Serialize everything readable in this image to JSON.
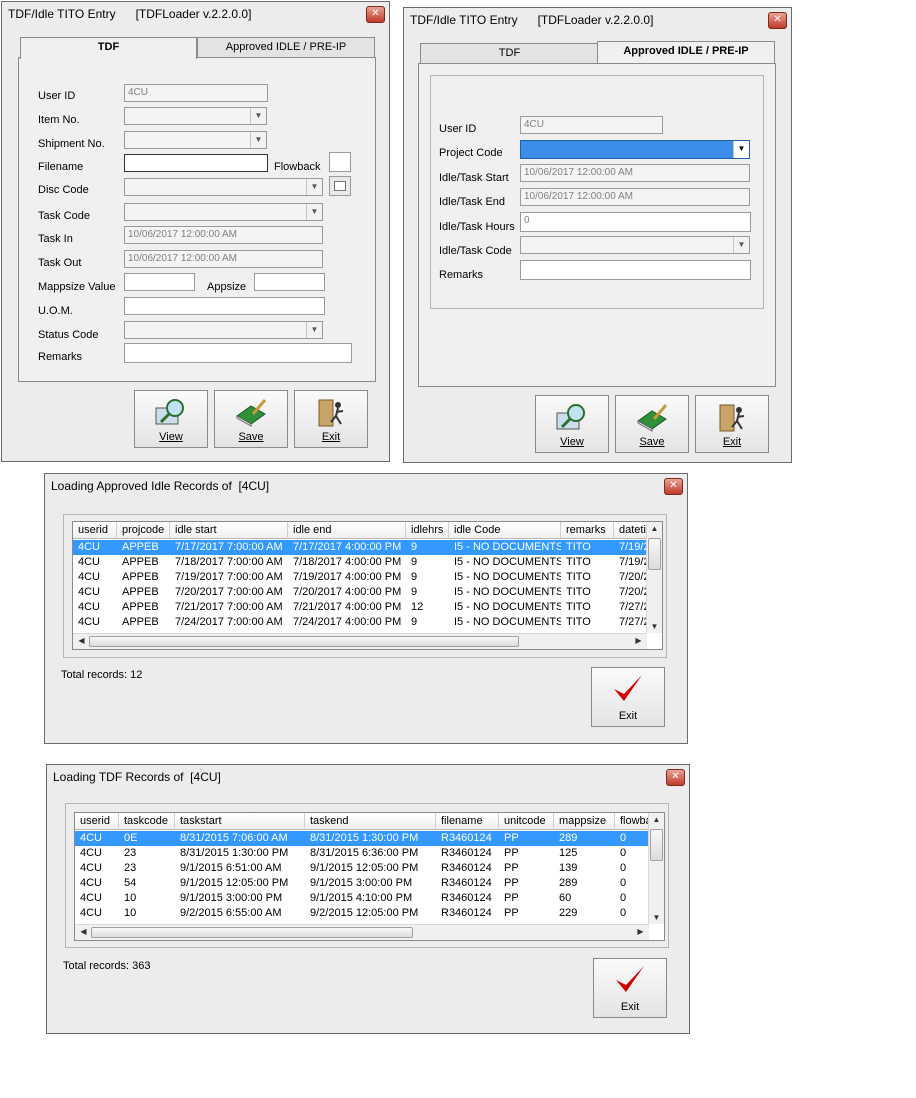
{
  "tdf_window": {
    "title": "TDF/Idle TITO Entry      [TDFLoader v.2.2.0.0]",
    "tabs": [
      "TDF",
      "Approved IDLE / PRE-IP"
    ],
    "labels": {
      "user_id": "User ID",
      "item_no": "Item No.",
      "shipment_no": "Shipment No.",
      "filename": "Filename",
      "flowback": "Flowback",
      "disc_code": "Disc Code",
      "task_code": "Task Code",
      "task_in": "Task In",
      "task_out": "Task Out",
      "mappsize_value": "Mappsize Value",
      "appsize": "Appsize",
      "uom": "U.O.M.",
      "status_code": "Status Code",
      "remarks": "Remarks"
    },
    "values": {
      "user_id": "4CU",
      "task_in": "10/06/2017 12:00:00 AM",
      "task_out": "10/06/2017 12:00:00 AM"
    },
    "buttons": {
      "view": "View",
      "save": "Save",
      "exit": "Exit"
    }
  },
  "idle_window": {
    "title": "TDF/Idle TITO Entry      [TDFLoader v.2.2.0.0]",
    "tabs": [
      "TDF",
      "Approved IDLE / PRE-IP"
    ],
    "labels": {
      "user_id": "User ID",
      "project_code": "Project Code",
      "start": "Idle/Task Start",
      "end": "Idle/Task End",
      "hours": "Idle/Task Hours",
      "code": "Idle/Task Code",
      "remarks": "Remarks"
    },
    "values": {
      "user_id": "4CU",
      "start": "10/06/2017 12:00:00 AM",
      "end": "10/06/2017 12:00:00 AM",
      "hours": "0"
    },
    "buttons": {
      "view": "View",
      "save": "Save",
      "exit": "Exit"
    }
  },
  "idle_records": {
    "title": "Loading Approved Idle Records of  [4CU]",
    "columns": [
      "userid",
      "projcode",
      "idle start",
      "idle end",
      "idlehrs",
      "idle Code",
      "remarks",
      "datetim"
    ],
    "rows": [
      [
        "4CU",
        "APPEB",
        "7/17/2017 7:00:00 AM",
        "7/17/2017 4:00:00 PM",
        "9",
        "I5 - NO DOCUMENTS",
        "TITO",
        "7/19/2"
      ],
      [
        "4CU",
        "APPEB",
        "7/18/2017 7:00:00 AM",
        "7/18/2017 4:00:00 PM",
        "9",
        "I5 - NO DOCUMENTS",
        "TITO",
        "7/19/2"
      ],
      [
        "4CU",
        "APPEB",
        "7/19/2017 7:00:00 AM",
        "7/19/2017 4:00:00 PM",
        "9",
        "I5 - NO DOCUMENTS",
        "TITO",
        "7/20/2"
      ],
      [
        "4CU",
        "APPEB",
        "7/20/2017 7:00:00 AM",
        "7/20/2017 4:00:00 PM",
        "9",
        "I5 - NO DOCUMENTS",
        "TITO",
        "7/20/2"
      ],
      [
        "4CU",
        "APPEB",
        "7/21/2017 7:00:00 AM",
        "7/21/2017 4:00:00 PM",
        "12",
        "I5 - NO DOCUMENTS",
        "TITO",
        "7/27/2"
      ],
      [
        "4CU",
        "APPEB",
        "7/24/2017 7:00:00 AM",
        "7/24/2017 4:00:00 PM",
        "9",
        "I5 - NO DOCUMENTS",
        "TITO",
        "7/27/2"
      ]
    ],
    "total": "Total records: 12",
    "exit": "Exit"
  },
  "tdf_records": {
    "title": "Loading TDF Records of  [4CU]",
    "columns": [
      "userid",
      "taskcode",
      "taskstart",
      "taskend",
      "filename",
      "unitcode",
      "mappsize",
      "flowba"
    ],
    "rows": [
      [
        "4CU",
        "0E",
        "8/31/2015 7:06:00 AM",
        "8/31/2015 1:30:00 PM",
        "R3460124",
        "PP",
        "289",
        "0"
      ],
      [
        "4CU",
        "23",
        "8/31/2015 1:30:00 PM",
        "8/31/2015 6:36:00 PM",
        "R3460124",
        "PP",
        "125",
        "0"
      ],
      [
        "4CU",
        "23",
        "9/1/2015 6:51:00 AM",
        "9/1/2015 12:05:00 PM",
        "R3460124",
        "PP",
        "139",
        "0"
      ],
      [
        "4CU",
        "54",
        "9/1/2015 12:05:00 PM",
        "9/1/2015 3:00:00 PM",
        "R3460124",
        "PP",
        "289",
        "0"
      ],
      [
        "4CU",
        "10",
        "9/1/2015 3:00:00 PM",
        "9/1/2015 4:10:00 PM",
        "R3460124",
        "PP",
        "60",
        "0"
      ],
      [
        "4CU",
        "10",
        "9/2/2015 6:55:00 AM",
        "9/2/2015 12:05:00 PM",
        "R3460124",
        "PP",
        "229",
        "0"
      ]
    ],
    "total": "Total records: 363",
    "exit": "Exit"
  },
  "colors": {
    "selection": "#3399ff",
    "close": "#c0392b",
    "checkmark": "#d40000"
  }
}
